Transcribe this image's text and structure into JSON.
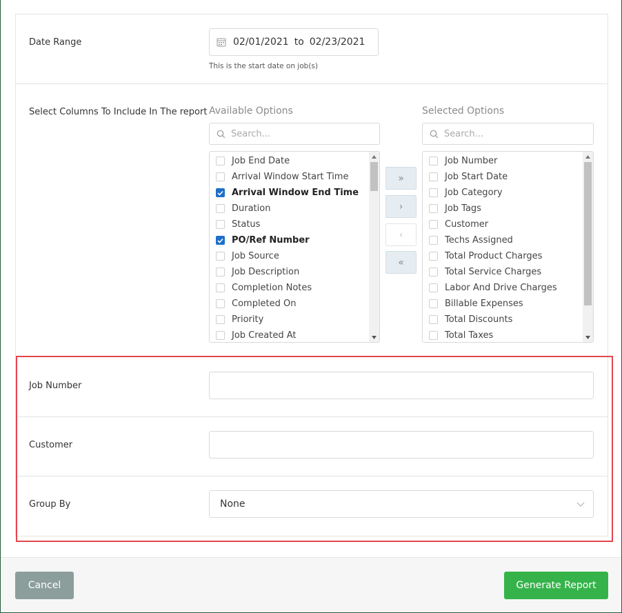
{
  "date_range": {
    "label": "Date Range",
    "start": "02/01/2021",
    "separator": "to",
    "end": "02/23/2021",
    "hint": "This is the start date on job(s)"
  },
  "columns": {
    "label": "Select Columns To Include In The report",
    "available": {
      "title": "Available Options",
      "search_placeholder": "Search...",
      "items": [
        {
          "label": "Job End Date",
          "checked": false
        },
        {
          "label": "Arrival Window Start Time",
          "checked": false
        },
        {
          "label": "Arrival Window End Time",
          "checked": true
        },
        {
          "label": "Duration",
          "checked": false
        },
        {
          "label": "Status",
          "checked": false
        },
        {
          "label": "PO/Ref Number",
          "checked": true
        },
        {
          "label": "Job Source",
          "checked": false
        },
        {
          "label": "Job Description",
          "checked": false
        },
        {
          "label": "Completion Notes",
          "checked": false
        },
        {
          "label": "Completed On",
          "checked": false
        },
        {
          "label": "Priority",
          "checked": false
        },
        {
          "label": "Job Created At",
          "checked": false
        }
      ]
    },
    "selected": {
      "title": "Selected Options",
      "search_placeholder": "Search...",
      "items": [
        {
          "label": "Job Number",
          "checked": false
        },
        {
          "label": "Job Start Date",
          "checked": false
        },
        {
          "label": "Job Category",
          "checked": false
        },
        {
          "label": "Job Tags",
          "checked": false
        },
        {
          "label": "Customer",
          "checked": false
        },
        {
          "label": "Techs Assigned",
          "checked": false
        },
        {
          "label": "Total Product Charges",
          "checked": false
        },
        {
          "label": "Total Service Charges",
          "checked": false
        },
        {
          "label": "Labor And Drive Charges",
          "checked": false
        },
        {
          "label": "Billable Expenses",
          "checked": false
        },
        {
          "label": "Total Discounts",
          "checked": false
        },
        {
          "label": "Total Taxes",
          "checked": false
        }
      ]
    },
    "move_buttons": {
      "move_all_right": "»",
      "move_right": "›",
      "move_left": "‹",
      "move_all_left": "«"
    }
  },
  "filters": {
    "job_number": {
      "label": "Job Number",
      "value": ""
    },
    "customer": {
      "label": "Customer",
      "value": ""
    },
    "group_by": {
      "label": "Group By",
      "value": "None"
    }
  },
  "footer": {
    "cancel_label": "Cancel",
    "generate_label": "Generate Report"
  },
  "colors": {
    "accent_green": "#35b34a",
    "checkbox_blue": "#1e6fc9",
    "highlight_red": "#e0474c"
  }
}
